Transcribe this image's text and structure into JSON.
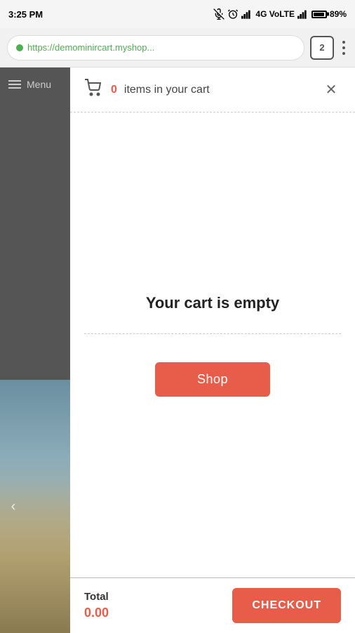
{
  "statusBar": {
    "time": "3:25 PM",
    "network": "4G VoLTE",
    "battery": "89%"
  },
  "browserBar": {
    "url": "https://demominircart.myshop...",
    "tabCount": "2"
  },
  "sidebar": {
    "menuLabel": "Menu"
  },
  "cart": {
    "header": {
      "itemCount": "0",
      "itemCountLabel": "items in your cart"
    },
    "body": {
      "emptyText": "Your cart is empty",
      "shopButtonLabel": "Shop"
    },
    "footer": {
      "totalLabel": "Total",
      "totalAmount": "0.00",
      "checkoutButtonLabel": "CHECKOUT"
    }
  }
}
